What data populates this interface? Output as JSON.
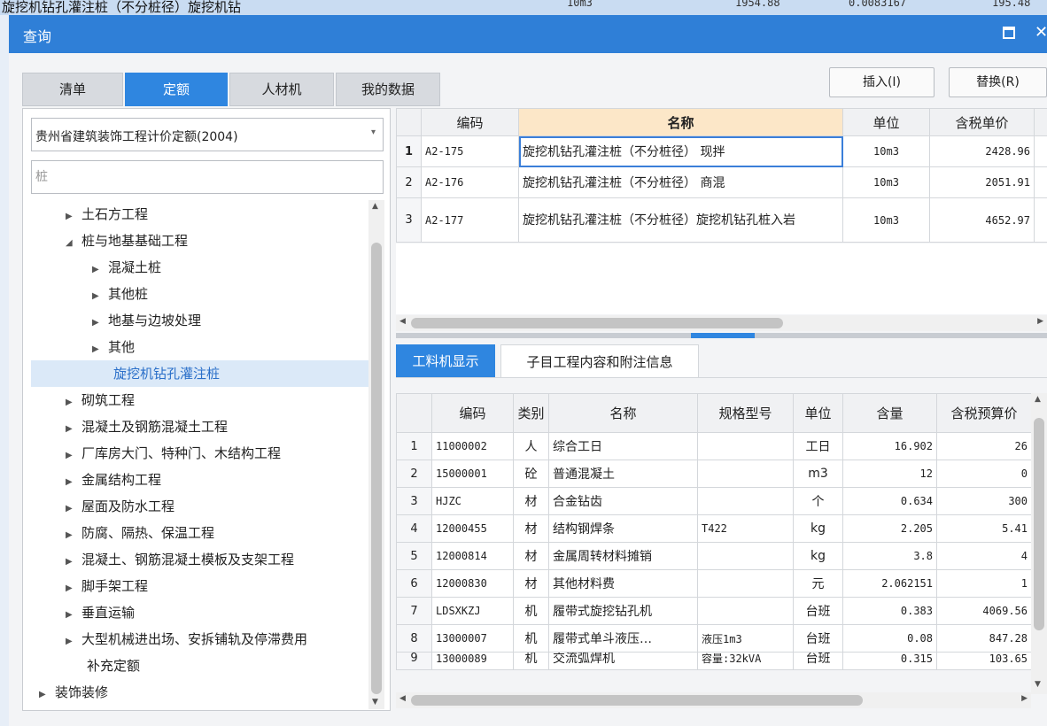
{
  "background": {
    "top_row_text": "旋挖机钻孔灌注桩（不分桩径）旋挖机钻",
    "top_row_cells": [
      "10m3",
      "1954.88",
      "0.0083167",
      "195.48"
    ]
  },
  "dialog": {
    "title": "查询",
    "maximize_glyph": "",
    "close_glyph": "✕"
  },
  "tabs": [
    {
      "label": "清单",
      "active": false
    },
    {
      "label": "定额",
      "active": true
    },
    {
      "label": "人材机",
      "active": false
    },
    {
      "label": "我的数据",
      "active": false
    }
  ],
  "buttons": {
    "insert": "插入(I)",
    "replace": "替换(R)"
  },
  "left": {
    "quota_library": "贵州省建筑装饰工程计价定额(2004)",
    "search_placeholder": "桩",
    "tree": [
      {
        "label": "土石方工程",
        "level": 1,
        "expanded": false
      },
      {
        "label": "桩与地基基础工程",
        "level": 1,
        "expanded": true
      },
      {
        "label": "混凝土桩",
        "level": 2,
        "expanded": false
      },
      {
        "label": "其他桩",
        "level": 2,
        "expanded": false
      },
      {
        "label": "地基与边坡处理",
        "level": 2,
        "expanded": false
      },
      {
        "label": "其他",
        "level": 2,
        "expanded": false
      },
      {
        "label": "旋挖机钻孔灌注桩",
        "level": 2,
        "leaf": true,
        "selected": true
      },
      {
        "label": "砌筑工程",
        "level": 1,
        "expanded": false
      },
      {
        "label": "混凝土及钢筋混凝土工程",
        "level": 1,
        "expanded": false
      },
      {
        "label": "厂库房大门、特种门、木结构工程",
        "level": 1,
        "expanded": false
      },
      {
        "label": "金属结构工程",
        "level": 1,
        "expanded": false
      },
      {
        "label": "屋面及防水工程",
        "level": 1,
        "expanded": false
      },
      {
        "label": "防腐、隔热、保温工程",
        "level": 1,
        "expanded": false
      },
      {
        "label": "混凝土、钢筋混凝土模板及支架工程",
        "level": 1,
        "expanded": false
      },
      {
        "label": "脚手架工程",
        "level": 1,
        "expanded": false
      },
      {
        "label": "垂直运输",
        "level": 1,
        "expanded": false
      },
      {
        "label": "大型机械进出场、安拆铺轨及停滞费用",
        "level": 1,
        "expanded": false
      },
      {
        "label": "补充定额",
        "level": 1,
        "leaf": true
      },
      {
        "label": "装饰装修",
        "level": 0,
        "expanded": false
      }
    ]
  },
  "quota_table": {
    "headers": [
      "编码",
      "名称",
      "单位",
      "含税单价"
    ],
    "rows": [
      {
        "no": "1",
        "code": "A2-175",
        "name": "旋挖机钻孔灌注桩（不分桩径） 现拌",
        "unit": "10m3",
        "price": "2428.96"
      },
      {
        "no": "2",
        "code": "A2-176",
        "name": "旋挖机钻孔灌注桩（不分桩径） 商混",
        "unit": "10m3",
        "price": "2051.91"
      },
      {
        "no": "3",
        "code": "A2-177",
        "name": "旋挖机钻孔灌注桩（不分桩径）旋挖机钻孔桩入岩",
        "unit": "10m3",
        "price": "4652.97"
      }
    ]
  },
  "subtabs": [
    {
      "label": "工料机显示",
      "active": true
    },
    {
      "label": "子目工程内容和附注信息",
      "active": false
    }
  ],
  "resource_table": {
    "headers": [
      "编码",
      "类别",
      "名称",
      "规格型号",
      "单位",
      "含量",
      "含税预算价"
    ],
    "rows": [
      {
        "no": "1",
        "code": "11000002",
        "cat": "人",
        "name": "综合工日",
        "spec": "",
        "unit": "工日",
        "qty": "16.902",
        "price": "26"
      },
      {
        "no": "2",
        "code": "15000001",
        "cat": "砼",
        "name": "普通混凝土",
        "spec": "",
        "unit": "m3",
        "qty": "12",
        "price": "0"
      },
      {
        "no": "3",
        "code": "HJZC",
        "cat": "材",
        "name": "合金钻齿",
        "spec": "",
        "unit": "个",
        "qty": "0.634",
        "price": "300"
      },
      {
        "no": "4",
        "code": "12000455",
        "cat": "材",
        "name": "结构钢焊条",
        "spec": "T422",
        "unit": "kg",
        "qty": "2.205",
        "price": "5.41"
      },
      {
        "no": "5",
        "code": "12000814",
        "cat": "材",
        "name": "金属周转材料摊销",
        "spec": "",
        "unit": "kg",
        "qty": "3.8",
        "price": "4"
      },
      {
        "no": "6",
        "code": "12000830",
        "cat": "材",
        "name": "其他材料费",
        "spec": "",
        "unit": "元",
        "qty": "2.062151",
        "price": "1"
      },
      {
        "no": "7",
        "code": "LDSXKZJ",
        "cat": "机",
        "name": "履带式旋挖钻孔机",
        "spec": "",
        "unit": "台班",
        "qty": "0.383",
        "price": "4069.56"
      },
      {
        "no": "8",
        "code": "13000007",
        "cat": "机",
        "name": "履带式单斗液压…",
        "spec": "液压1m3",
        "unit": "台班",
        "qty": "0.08",
        "price": "847.28"
      },
      {
        "no": "9",
        "code": "13000089",
        "cat": "机",
        "name": "交流弧焊机",
        "spec": "容量:32kVA",
        "unit": "台班",
        "qty": "0.315",
        "price": "103.65"
      }
    ]
  }
}
